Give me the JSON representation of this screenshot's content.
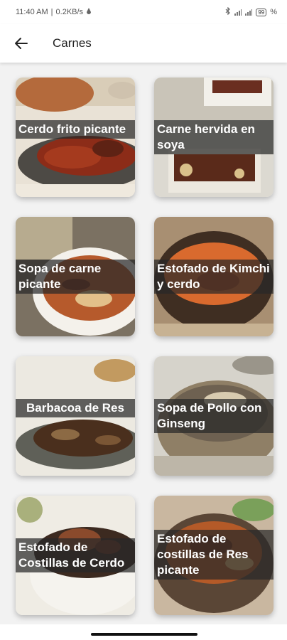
{
  "status_bar": {
    "time": "11:40 AM",
    "speed": "0.2KB/s",
    "battery": "99",
    "battery_suffix": "%"
  },
  "app_bar": {
    "back_icon": "arrow-left-icon",
    "title": "Carnes"
  },
  "recipes": [
    {
      "name": "Cerdo frito picante"
    },
    {
      "name": "Carne hervida en soya"
    },
    {
      "name": "Sopa de carne picante"
    },
    {
      "name": "Estofado de Kimchi y cerdo"
    },
    {
      "name": "Barbacoa de Res"
    },
    {
      "name": "Sopa de Pollo con Ginseng"
    },
    {
      "name": "Estofado de Costillas de Cerdo"
    },
    {
      "name": "Estofado de costillas de Res picante"
    }
  ]
}
